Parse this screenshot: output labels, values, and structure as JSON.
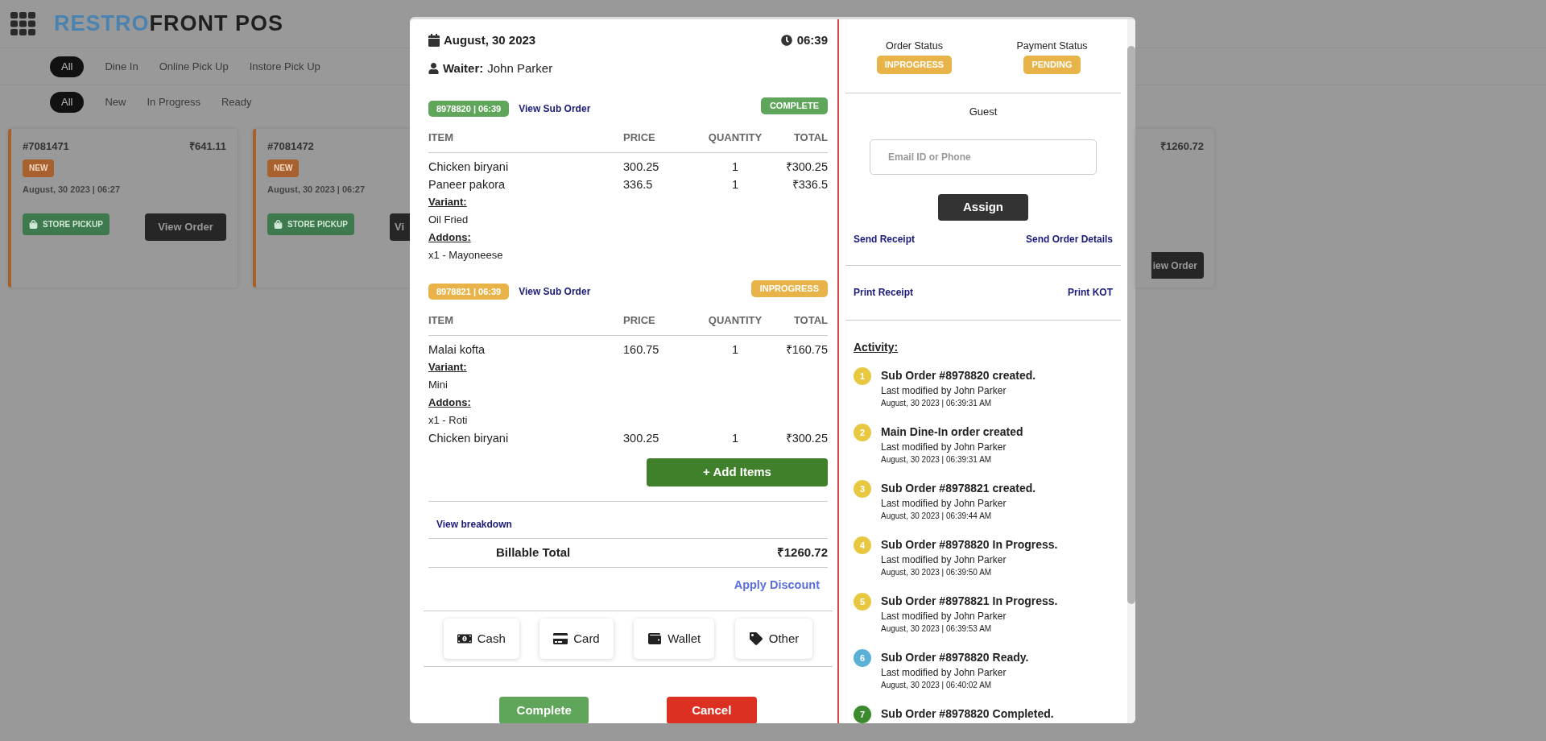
{
  "background": {
    "logo": {
      "part_1": "RESTRO",
      "part_2": "FRONT POS"
    },
    "type_tabs": [
      {
        "label": "All",
        "selected": true
      },
      {
        "label": "Dine In",
        "selected": false
      },
      {
        "label": "Online Pick Up",
        "selected": false
      },
      {
        "label": "Instore Pick Up",
        "selected": false
      }
    ],
    "status_tabs": [
      {
        "label": "All",
        "selected": true
      },
      {
        "label": "New",
        "selected": false
      },
      {
        "label": "In Progress",
        "selected": false
      },
      {
        "label": "Ready",
        "selected": false
      }
    ],
    "cards": [
      {
        "number": "#7081471",
        "amount": "₹641.11",
        "badge": "NEW",
        "date": "August, 30 2023 | 06:27",
        "pickup": "STORE PICKUP",
        "view": "View Order"
      },
      {
        "number": "#7081472",
        "badge": "NEW",
        "date": "August, 30 2023 | 06:27",
        "pickup": "STORE PICKUP",
        "view": "Vi"
      }
    ],
    "right_card": {
      "amount": "₹1260.72",
      "view": "iew Order"
    }
  },
  "order": {
    "date": "August, 30 2023",
    "time": "06:39",
    "waiter_label": "Waiter:",
    "waiter": "John Parker",
    "sub_orders": [
      {
        "id": "8978820 | 06:39",
        "kind": "complete",
        "columns": [
          "ITEM",
          "PRICE",
          "QUANTITY",
          "TOTAL"
        ],
        "status_label": "COMPLETE",
        "link": "View Sub Order",
        "items": [
          {
            "name": "Chicken biryani",
            "price": "300.25",
            "quantity": "1",
            "total": "₹300.25"
          },
          {
            "name": "Paneer pakora",
            "price": "336.5",
            "quantity": "1",
            "total": "₹336.5",
            "variant": {
              "label": "Variant:",
              "value": "Oil Fried"
            },
            "addons": {
              "label": "Addons:",
              "value": "x1 - Mayoneese"
            }
          }
        ]
      },
      {
        "id": "8978821 | 06:39",
        "kind": "inprogress",
        "columns": [
          "ITEM",
          "PRICE",
          "QUANTITY",
          "TOTAL"
        ],
        "status_label": "INPROGRESS",
        "link": "View Sub Order",
        "items": [
          {
            "name": "Malai kofta",
            "price": "160.75",
            "quantity": "1",
            "total": "₹160.75",
            "variant": {
              "label": "Variant:",
              "value": "Mini"
            },
            "addons": {
              "label": "Addons:",
              "value": "x1 - Roti"
            }
          },
          {
            "name": "Chicken biryani",
            "price": "300.25",
            "quantity": "1",
            "total": "₹300.25"
          }
        ]
      }
    ],
    "add_items": "+ Add Items",
    "breakdown": "View breakdown",
    "billable_label": "Billable Total",
    "billable_total": "₹1260.72",
    "discount": "Apply Discount",
    "payment_methods": [
      {
        "kind": "cash",
        "label": "Cash"
      },
      {
        "kind": "card",
        "label": "Card"
      },
      {
        "kind": "wallet",
        "label": "Wallet"
      },
      {
        "kind": "other",
        "label": "Other"
      }
    ],
    "complete": "Complete",
    "cancel": "Cancel"
  },
  "side": {
    "order_status": {
      "label": "Order Status",
      "value": "INPROGRESS"
    },
    "payment_status": {
      "label": "Payment Status",
      "value": "PENDING"
    },
    "guest": "Guest",
    "contact": {
      "placeholder": "Email ID or Phone"
    },
    "assign": "Assign",
    "send_receipt": "Send Receipt",
    "send_details": "Send Order Details",
    "print_receipt": "Print Receipt",
    "print_kot": "Print KOT",
    "activity_title": "Activity:",
    "activity": [
      {
        "number": "1",
        "color": "#e8c840",
        "title": "Sub Order #8978820 created.",
        "by": "Last modified by John Parker",
        "time": "August, 30 2023 | 06:39:31 AM"
      },
      {
        "number": "2",
        "color": "#e8c840",
        "title": "Main Dine-In order created",
        "by": "Last modified by John Parker",
        "time": "August, 30 2023 | 06:39:31 AM"
      },
      {
        "number": "3",
        "color": "#e8c840",
        "title": "Sub Order #8978821 created.",
        "by": "Last modified by John Parker",
        "time": "August, 30 2023 | 06:39:44 AM"
      },
      {
        "number": "4",
        "color": "#e8c840",
        "title": "Sub Order #8978820 In Progress.",
        "by": "Last modified by John Parker",
        "time": "August, 30 2023 | 06:39:50 AM"
      },
      {
        "number": "5",
        "color": "#e8c840",
        "title": "Sub Order #8978821 In Progress.",
        "by": "Last modified by John Parker",
        "time": "August, 30 2023 | 06:39:53 AM"
      },
      {
        "number": "6",
        "color": "#5bb0d8",
        "title": "Sub Order #8978820 Ready.",
        "by": "Last modified by John Parker",
        "time": "August, 30 2023 | 06:40:02 AM"
      },
      {
        "number": "7",
        "color": "#3c8a2e",
        "title": "Sub Order #8978820 Completed."
      }
    ]
  }
}
